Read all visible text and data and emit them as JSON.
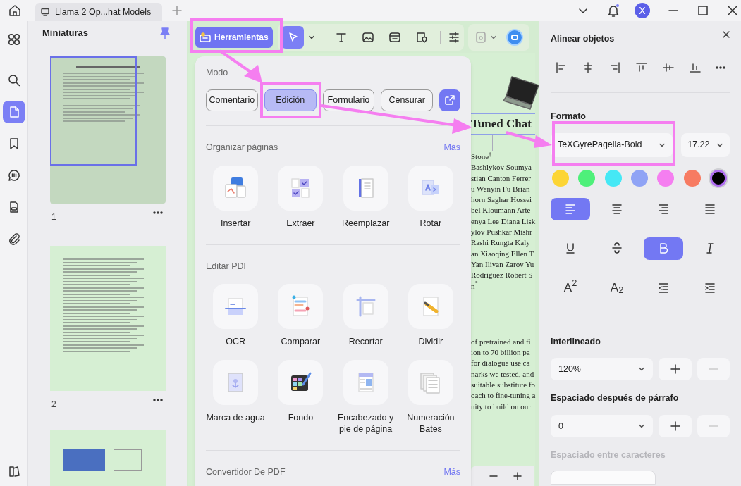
{
  "tab": {
    "title": "Llama 2 Op...hat Models"
  },
  "user": {
    "initial": "X"
  },
  "rail": [
    {
      "selected": false
    },
    {
      "selected": false
    },
    {
      "selected": true
    },
    {
      "selected": false
    },
    {
      "selected": false
    },
    {
      "selected": false
    },
    {
      "selected": false
    }
  ],
  "thumbnails": {
    "title": "Miniaturas",
    "pages": [
      {
        "label": "1",
        "selected": true
      },
      {
        "label": "2",
        "selected": false
      }
    ]
  },
  "toolbar": {
    "tools_button": "Herramientas",
    "tools": [
      {
        "selected": true
      },
      {
        "selected": false
      },
      {
        "selected": false
      },
      {
        "selected": false
      },
      {
        "selected": false
      }
    ]
  },
  "tools_menu": {
    "mode_title": "Modo",
    "modes": [
      {
        "label": "Comentario",
        "selected": false
      },
      {
        "label": "Edición",
        "selected": true
      },
      {
        "label": "Formulario",
        "selected": false
      },
      {
        "label": "Censurar",
        "selected": false
      }
    ],
    "sections": [
      {
        "title": "Organizar páginas",
        "more": "Más",
        "items": [
          "Insertar",
          "Extraer",
          "Reemplazar",
          "Rotar"
        ]
      },
      {
        "title": "Editar PDF",
        "items": [
          "OCR",
          "Comparar",
          "Recortar",
          "Dividir",
          "Marca de agua",
          "Fondo",
          "Encabezado y pie de página",
          "Numeración Bates"
        ]
      },
      {
        "title": "Convertidor De PDF",
        "more": "Más"
      }
    ]
  },
  "document": {
    "title": "Tuned Chat",
    "author_lines": [
      "Stone$^{†}$",
      "Bashlykov Soumya",
      "stian Canton Ferrer",
      "u Wenyin Fu Brian",
      "horn Saghar Hossei",
      "bel Kloumann Arte",
      "enya Lee Diana Lisk",
      "ylov Pushkar Mishr",
      "Rashi Rungta Kaly",
      "an Xiaoqing Ellen T",
      "Yan Iliyan Zarov Yu",
      "Rodriguez Robert S",
      "n$^{*}$"
    ],
    "abstract_lines": [
      "of pretrained and fi",
      "ion to 70 billion pa",
      "for dialogue use ca",
      "narks we tested, and",
      "suitable substitute fo",
      "oach to fine-tuning a",
      "nity to build on our"
    ]
  },
  "properties": {
    "align_title": "Alinear objetos",
    "format_title": "Formato",
    "font": "TeXGyrePagella-Bold",
    "size": "17.22",
    "colors": [
      {
        "color": "#fcd535",
        "selected": false
      },
      {
        "color": "#4ef07a",
        "selected": false
      },
      {
        "color": "#45e8f5",
        "selected": false
      },
      {
        "color": "#8fa3f5",
        "selected": false
      },
      {
        "color": "#f57ef0",
        "selected": false
      },
      {
        "color": "#f77b62",
        "selected": false
      },
      {
        "color": "#000000",
        "selected": true
      }
    ],
    "alignment": [
      {
        "selected": true
      },
      {
        "selected": false
      },
      {
        "selected": false
      },
      {
        "selected": false
      }
    ],
    "styles": [
      {
        "kind": "underline",
        "on": false
      },
      {
        "kind": "strike",
        "on": false
      },
      {
        "kind": "bold",
        "on": true
      },
      {
        "kind": "italic",
        "on": false
      }
    ],
    "scripts": [
      "A$^{2}$",
      "A$_{2}$"
    ],
    "line_spacing": {
      "title": "Interlineado",
      "value": "120%",
      "minus_disabled": true
    },
    "paragraph_spacing": {
      "title": "Espaciado después de párrafo",
      "value": "0",
      "minus_disabled": true
    },
    "char_spacing": {
      "title": "Espaciado entre caracteres",
      "disabled": true
    }
  }
}
